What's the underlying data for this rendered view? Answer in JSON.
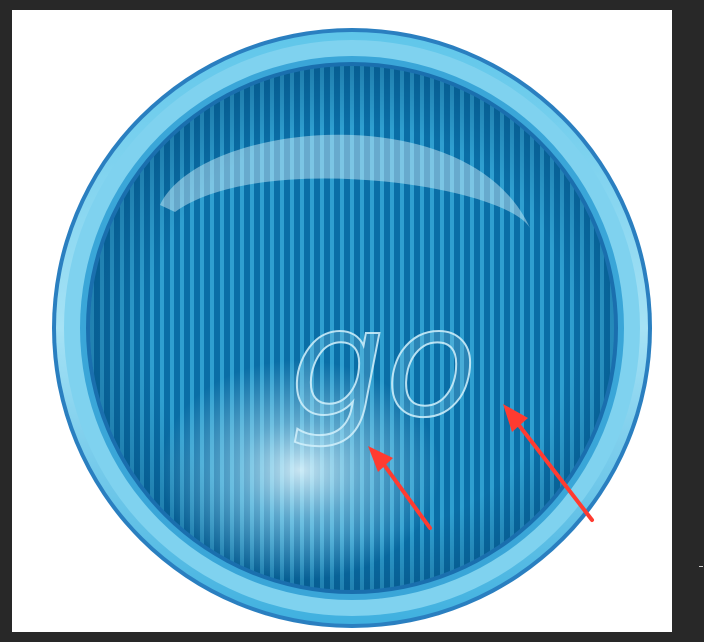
{
  "workspace": {
    "background": "#282828",
    "canvas_background": "#ffffff"
  },
  "button": {
    "label": "go",
    "colors": {
      "rim_outer": "#1e6fb3",
      "rim_light": "#8ed6ef",
      "face_stripe_dark": "#0a6ea6",
      "face_stripe_light": "#2f9fd0",
      "highlight": "#cfeefa"
    }
  },
  "annotations": {
    "arrows": [
      {
        "name": "arrow-to-g",
        "color": "#ff3b30"
      },
      {
        "name": "arrow-to-o",
        "color": "#ff3b30"
      }
    ]
  }
}
